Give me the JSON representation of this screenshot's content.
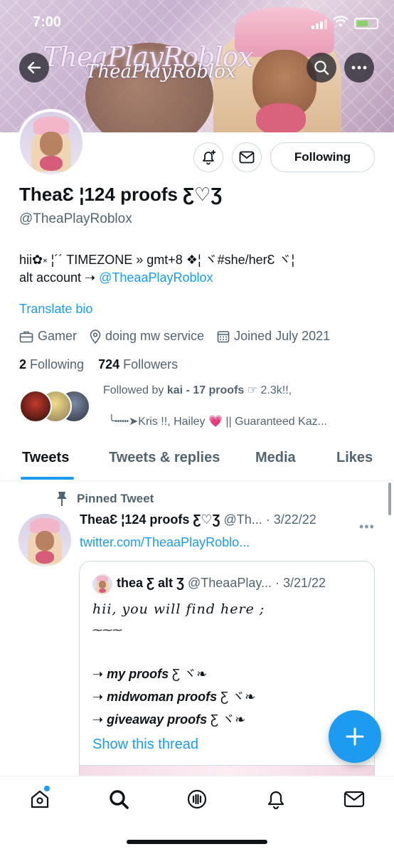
{
  "status_bar": {
    "time": "7:00"
  },
  "banner": {
    "logo_text": "TheaPlayRoblox",
    "logo_subtext": "TheaPlayRoblox"
  },
  "profile": {
    "name": "TheaƐ ¦124 proofs Ƹ♡Ʒ",
    "handle": "@TheaPlayRoblox",
    "follow_button": "Following",
    "bio_line1": "hii✿༝ ¦´´ TIMEZONE » gmt+8 ❖¦ ヾ#she/herƐ ヾ¦",
    "bio_line2_prefix": "alt account ➝ ",
    "bio_line2_link": "@TheaaPlayRoblox",
    "translate": "Translate bio",
    "category": "Gamer",
    "location": "doing mw service",
    "joined": "Joined July 2021",
    "following_count": "2",
    "following_label": "Following",
    "followers_count": "724",
    "followers_label": "Followers",
    "followed_by_prefix": "Followed by ",
    "followed_by_name": "kai - 17 proofs",
    "followed_by_rest": " ☞ 2.3k!!,",
    "followed_by_line2": "╰┅┅➤Kris !!, Hailey 💗 || Guaranteed Kaz..."
  },
  "tabs": [
    {
      "label": "Tweets"
    },
    {
      "label": "Tweets & replies"
    },
    {
      "label": "Media"
    },
    {
      "label": "Likes"
    }
  ],
  "pinned_tweet": {
    "pinned_label": "Pinned Tweet",
    "author_name": "TheaƐ ¦124 proofs Ƹ♡Ʒ",
    "author_meta": " @Th... · 3/22/22",
    "link": "twitter.com/TheaaPlayRoblo...",
    "quote": {
      "author_name": "thea Ƹ alt Ʒ",
      "author_meta": " @TheaaPlay... · 3/21/22",
      "line1": "hii, you will find here ;",
      "line2": "⁓⁓⁓",
      "item1": "my proofs",
      "item2": "midwoman proofs",
      "item3": "giveaway proofs",
      "arrow": "➝ ",
      "suffix": " Ƹ ヾ❧",
      "show_thread": "Show this thread"
    }
  },
  "colors": {
    "accent": "#1d9bf0",
    "text": "#0f1419",
    "secondary": "#536471",
    "border": "#cfd9de"
  }
}
